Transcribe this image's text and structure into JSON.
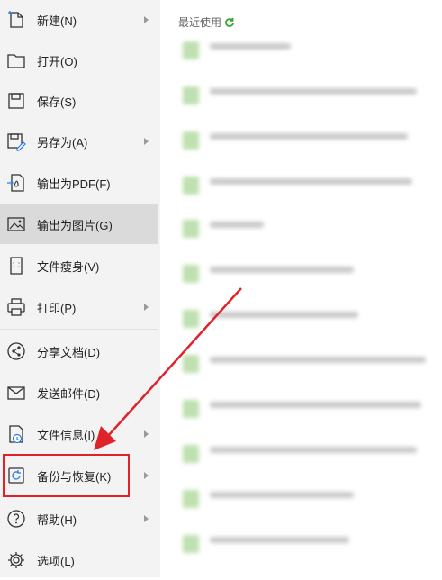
{
  "menu": {
    "items": [
      {
        "id": "new",
        "label": "新建(N)",
        "icon": "new-doc-icon",
        "chevron": true
      },
      {
        "id": "open",
        "label": "打开(O)",
        "icon": "folder-icon",
        "chevron": false
      },
      {
        "id": "save",
        "label": "保存(S)",
        "icon": "save-icon",
        "chevron": false
      },
      {
        "id": "save-as",
        "label": "另存为(A)",
        "icon": "save-as-icon",
        "chevron": true
      },
      {
        "id": "export-pdf",
        "label": "输出为PDF(F)",
        "icon": "pdf-export-icon",
        "chevron": false
      },
      {
        "id": "export-image",
        "label": "输出为图片(G)",
        "icon": "image-export-icon",
        "chevron": false,
        "selected": true
      },
      {
        "id": "slim",
        "label": "文件瘦身(V)",
        "icon": "file-slim-icon",
        "chevron": false
      },
      {
        "id": "print",
        "label": "打印(P)",
        "icon": "printer-icon",
        "chevron": true
      },
      {
        "id": "share",
        "label": "分享文档(D)",
        "icon": "share-icon",
        "chevron": false
      },
      {
        "id": "send-mail",
        "label": "发送邮件(D)",
        "icon": "mail-icon",
        "chevron": false
      },
      {
        "id": "file-info",
        "label": "文件信息(I)",
        "icon": "info-icon",
        "chevron": true
      },
      {
        "id": "backup",
        "label": "备份与恢复(K)",
        "icon": "backup-icon",
        "chevron": true,
        "highlighted": true
      },
      {
        "id": "help",
        "label": "帮助(H)",
        "icon": "help-icon",
        "chevron": true
      },
      {
        "id": "options",
        "label": "选项(L)",
        "icon": "gear-icon",
        "chevron": false
      }
    ]
  },
  "recent": {
    "title": "最近使用",
    "refresh_icon": "refresh-icon"
  },
  "colors": {
    "sidebar_bg": "#f3f3f3",
    "selected_bg": "#dadada",
    "annotation_red": "#e0232b",
    "refresh_green": "#3aa335"
  }
}
